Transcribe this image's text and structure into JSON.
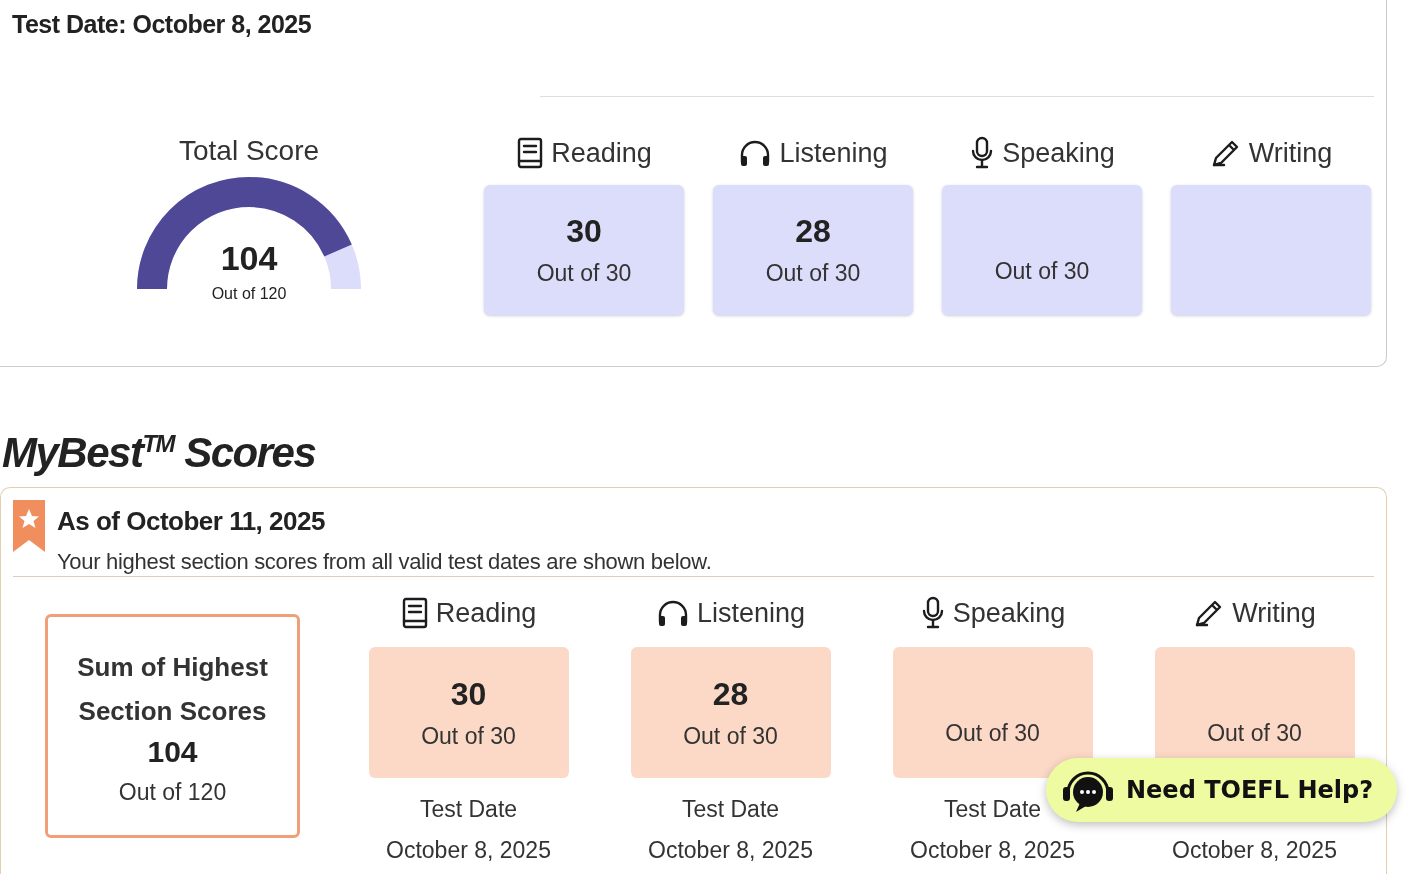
{
  "test_date": "Test Date: October 8, 2025",
  "total": {
    "label": "Total Score",
    "score": "104",
    "out_of": "Out of 120"
  },
  "sections": [
    {
      "kind": "reading",
      "label": "Reading",
      "score": "30",
      "out_of": "Out of 30"
    },
    {
      "kind": "listening",
      "label": "Listening",
      "score": "28",
      "out_of": "Out of 30"
    },
    {
      "kind": "speaking",
      "label": "Speaking",
      "out_of": "Out of 30"
    },
    {
      "kind": "writing",
      "label": "Writing"
    }
  ],
  "mybest": {
    "title": "MyBest$^{TM}$ Scores",
    "as_of": "As of October 11, 2025",
    "note": "Your highest section scores from all valid test dates are shown below.",
    "sum": {
      "label": "Sum of Highest Section Scores",
      "score": "104",
      "out_of": "Out of 120"
    },
    "sections": [
      {
        "kind": "reading",
        "label": "Reading",
        "score": "30",
        "out_of": "Out of 30",
        "date_label": "Test Date",
        "date": "October 8, 2025"
      },
      {
        "kind": "listening",
        "label": "Listening",
        "score": "28",
        "out_of": "Out of 30",
        "date_label": "Test Date",
        "date": "October 8, 2025"
      },
      {
        "kind": "speaking",
        "label": "Speaking",
        "out_of": "Out of 30",
        "date_label": "Test Date",
        "date": "October 8, 2025"
      },
      {
        "kind": "writing",
        "label": "Writing",
        "out_of": "Out of 30",
        "date": "October 8, 2025"
      }
    ]
  },
  "help_button": "Need TOEFL Help?"
}
